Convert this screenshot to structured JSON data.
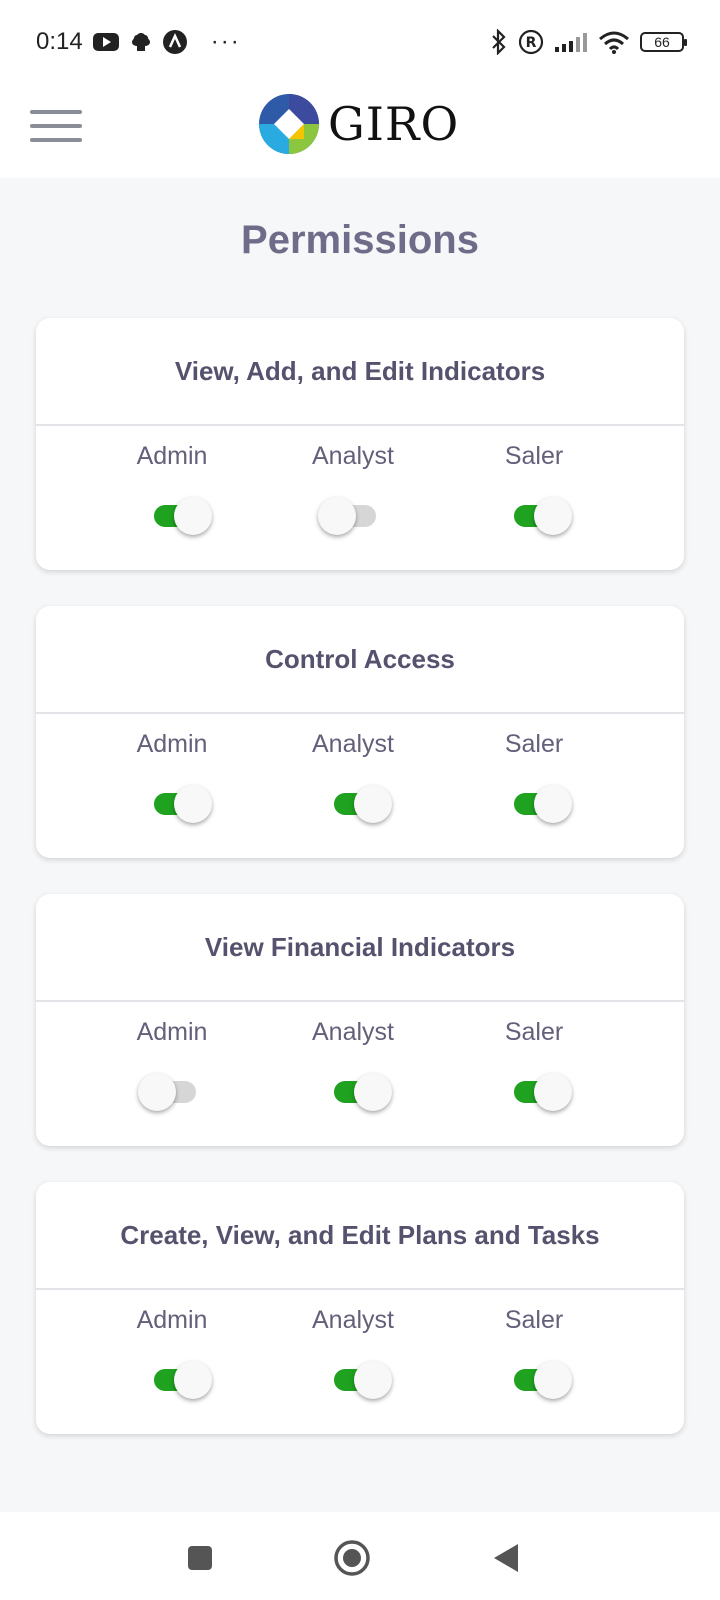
{
  "status": {
    "time": "0:14",
    "battery": "66",
    "left_icons": [
      "youtube-icon",
      "notification-icon",
      "app-icon",
      "more-dots-icon"
    ],
    "right_icons": [
      "bluetooth-icon",
      "registered-icon",
      "signal-icon",
      "wifi-icon",
      "battery-icon"
    ]
  },
  "app": {
    "logo_text": "GIRO"
  },
  "page": {
    "title": "Permissions"
  },
  "roles": [
    "Admin",
    "Analyst",
    "Saler"
  ],
  "cards": [
    {
      "title": "View, Add, and Edit Indicators",
      "toggles": {
        "Admin": true,
        "Analyst": false,
        "Saler": true
      }
    },
    {
      "title": "Control Access",
      "toggles": {
        "Admin": true,
        "Analyst": true,
        "Saler": true
      }
    },
    {
      "title": "View Financial Indicators",
      "toggles": {
        "Admin": false,
        "Analyst": true,
        "Saler": true
      }
    },
    {
      "title": "Create, View, and Edit Plans and Tasks",
      "toggles": {
        "Admin": true,
        "Analyst": true,
        "Saler": true
      }
    }
  ],
  "colors": {
    "toggle_on": "#1fa21f",
    "toggle_off": "#d6d6d6",
    "title": "#6f6c8a",
    "background": "#f6f7f9"
  },
  "nav": [
    "recent-apps-icon",
    "home-icon",
    "back-icon"
  ]
}
